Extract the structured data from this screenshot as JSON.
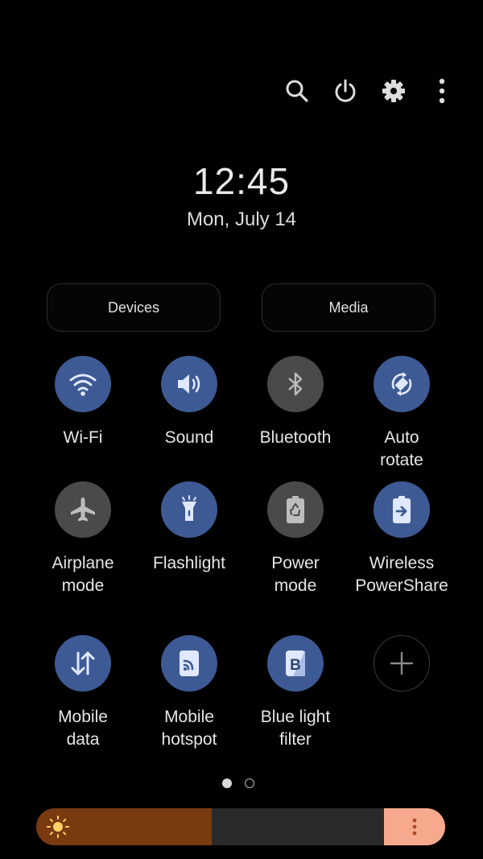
{
  "header": {
    "icons": [
      "search-icon",
      "power-icon",
      "settings-icon",
      "more-options-icon"
    ]
  },
  "clock": {
    "time": "12:45",
    "date": "Mon, July 14"
  },
  "panels": {
    "devices_label": "Devices",
    "media_label": "Media"
  },
  "tiles": [
    {
      "label": "Wi-Fi",
      "state": "on",
      "icon": "wifi-icon"
    },
    {
      "label": "Sound",
      "state": "on",
      "icon": "sound-icon"
    },
    {
      "label": "Bluetooth",
      "state": "off",
      "icon": "bluetooth-icon"
    },
    {
      "label": "Auto\nrotate",
      "state": "on",
      "icon": "auto-rotate-icon"
    },
    {
      "label": "Airplane\nmode",
      "state": "off",
      "icon": "airplane-icon"
    },
    {
      "label": "Flashlight",
      "state": "on",
      "icon": "flashlight-icon"
    },
    {
      "label": "Power\nmode",
      "state": "off",
      "icon": "power-mode-icon"
    },
    {
      "label": "Wireless\nPowerShare",
      "state": "on",
      "icon": "wireless-powershare-icon"
    },
    {
      "label": "Mobile\ndata",
      "state": "on",
      "icon": "mobile-data-icon"
    },
    {
      "label": "Mobile\nhotspot",
      "state": "on",
      "icon": "mobile-hotspot-icon"
    },
    {
      "label": "Blue light\nfilter",
      "state": "on",
      "icon": "blue-light-filter-icon"
    },
    {
      "label": "",
      "state": "add",
      "icon": "plus-icon"
    }
  ],
  "pagination": {
    "pages": 2,
    "current": 1
  },
  "brightness": {
    "level": 0.43,
    "colors": {
      "fill": "#7a3a10",
      "track": "#2a2a2a",
      "end": "#f7a98d"
    }
  },
  "colors": {
    "tile_on": "#3d5a94",
    "tile_off": "#4a4a4a",
    "icon_on": "#dfe8ff",
    "icon_off": "#bdbdbd"
  }
}
